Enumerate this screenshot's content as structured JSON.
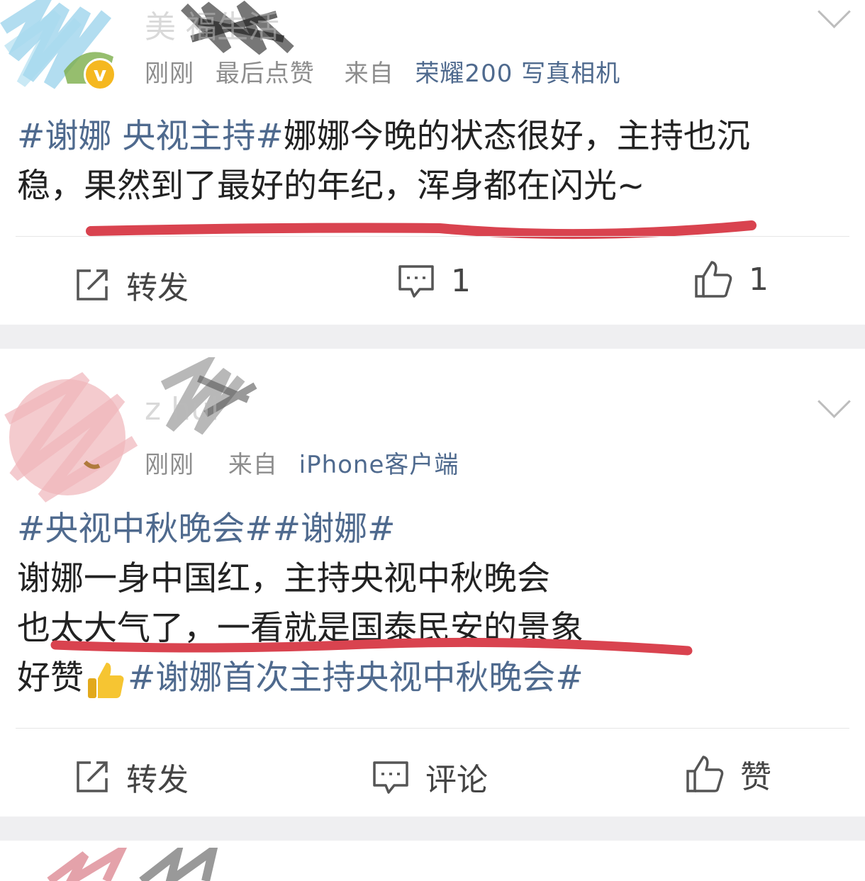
{
  "post1": {
    "username": "美 福生活",
    "time": "刚刚",
    "last_like": "最后点赞",
    "source_prefix": "来自",
    "source": "荣耀200 写真相机",
    "tag1": "#谢娜 央视主持#",
    "text1": "娜娜今晚的状态很好，主持也沉",
    "text2": "稳，果然到了最好的年纪，浑身都在闪光~",
    "repost_label": "转发",
    "comment_count": "1",
    "like_count": "1"
  },
  "post2": {
    "username": "z hui",
    "time": "刚刚",
    "source_prefix": "来自",
    "source": "iPhone客户端",
    "tags_line": "#央视中秋晚会##谢娜#",
    "line2": "谢娜一身中国红，主持央视中秋晚会",
    "line3": "也太大气了，一看就是国泰民安的景象",
    "line4_text": "好赞",
    "line4_tag": "#谢娜首次主持央视中秋晚会#",
    "repost_label": "转发",
    "comment_label": "评论",
    "like_label": "赞"
  },
  "colors": {
    "link": "#4f6a8e",
    "annotation": "#d9434f",
    "separator": "#efeff1"
  },
  "icons": {
    "verified": "verified-badge-icon",
    "repost": "repost-icon",
    "comment": "comment-icon",
    "like": "thumbs-up-icon",
    "more": "chevron-down-icon"
  }
}
